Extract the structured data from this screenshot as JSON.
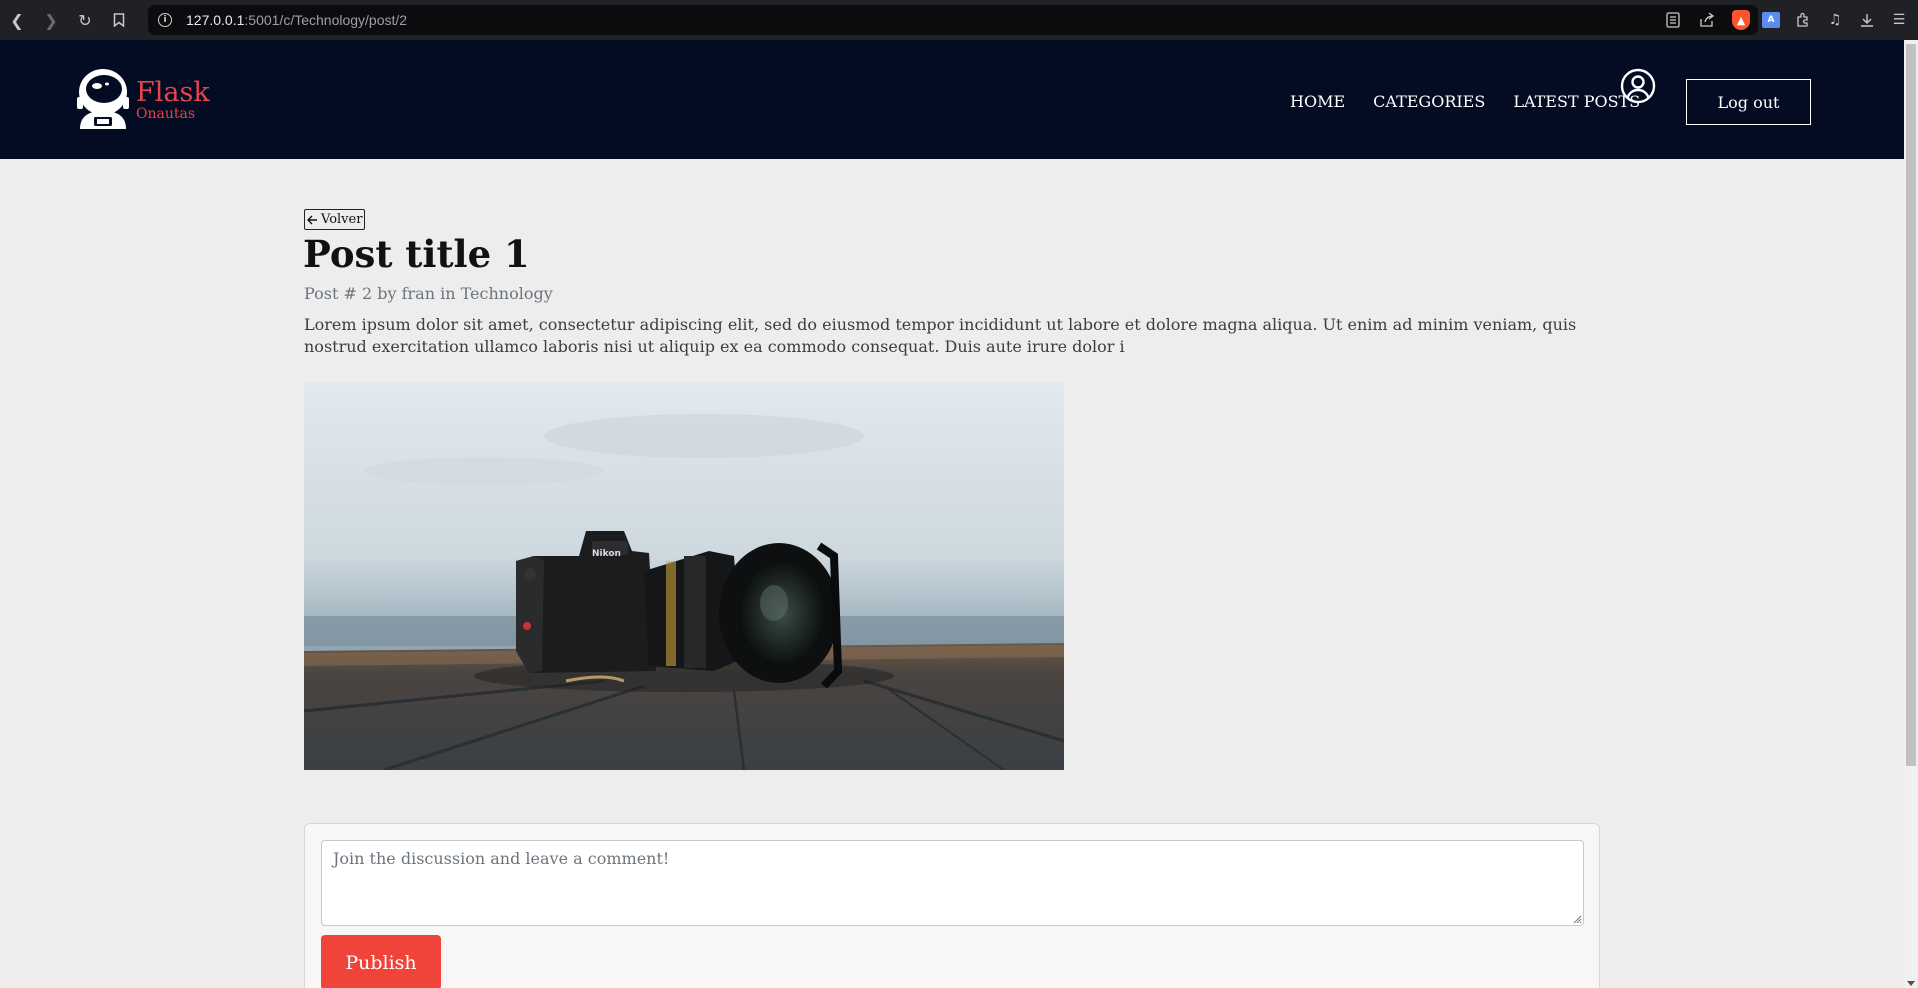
{
  "browser": {
    "url_host": "127.0.0.1",
    "url_rest": ":5001/c/Technology/post/2"
  },
  "header": {
    "logo_brand": "Flask",
    "logo_sub": "Onautas",
    "nav": [
      "HOME",
      "CATEGORIES",
      "LATEST POSTS"
    ],
    "logout_label": "Log out"
  },
  "post": {
    "back_label": "Volver",
    "title": "Post title 1",
    "meta": "Post # 2 by fran in Technology",
    "body": "Lorem ipsum dolor sit amet, consectetur adipiscing elit, sed do eiusmod tempor incididunt ut labore et dolore magna aliqua. Ut enim ad minim veniam, quis nostrud exercitation ullamco laboris nisi ut aliquip ex ea commodo consequat. Duis aute irure dolor i",
    "camera_brand": "Nikon"
  },
  "comment": {
    "placeholder": "Join the discussion and leave a comment!",
    "publish_label": "Publish"
  },
  "colors": {
    "header_bg": "#040c24",
    "accent": "#e8424b",
    "publish_bg": "#f0443b",
    "page_bg": "#ededed"
  }
}
